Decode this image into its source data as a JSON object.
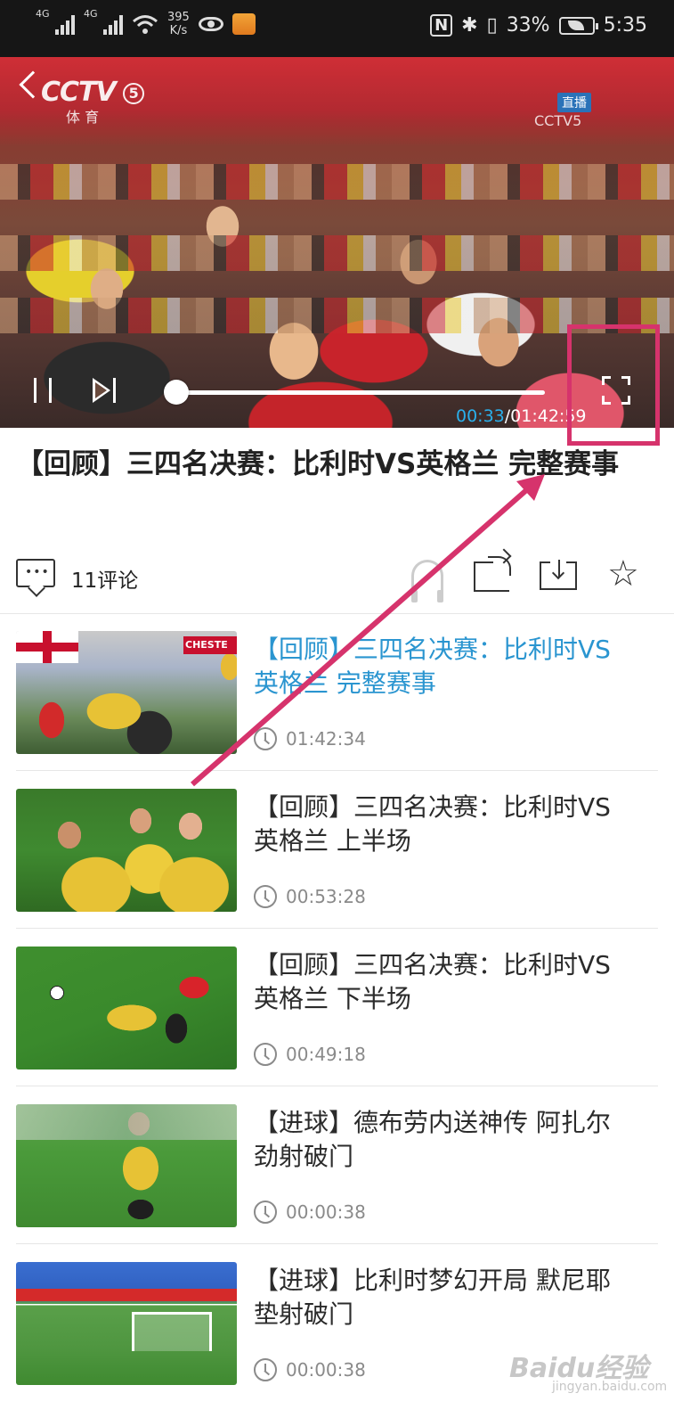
{
  "status_bar": {
    "signal_1_label": "4G",
    "signal_2_label": "4G",
    "net_speed_value": "395",
    "net_speed_unit": "K/s",
    "nfc_label": "N",
    "bluetooth_label": "✱",
    "vibrate_label": "▯",
    "battery_percent": "33%",
    "time": "5:35"
  },
  "player": {
    "channel_logo": "CCTV",
    "channel_number": "5",
    "channel_sub": "体 育",
    "live_tag": "直播",
    "corner_logo": "CCTV5",
    "current_time": "00:33",
    "time_separator": "/",
    "total_time": "01:42:59",
    "progress_fraction": 0.005,
    "accent_color": "#2aa6e0"
  },
  "video": {
    "title": "【回顾】三四名决赛：比利时VS英格兰 完整赛事"
  },
  "actions": {
    "comment_label": "11评论",
    "comment_icon_dots": "•••",
    "star_glyph": "☆"
  },
  "playlist": [
    {
      "title": "【回顾】三四名决赛：比利时VS英格兰 完整赛事",
      "duration": "01:42:34",
      "active": true,
      "thumb_board": "CHESTE"
    },
    {
      "title": "【回顾】三四名决赛：比利时VS英格兰 上半场",
      "duration": "00:53:28",
      "active": false
    },
    {
      "title": "【回顾】三四名决赛：比利时VS英格兰 下半场",
      "duration": "00:49:18",
      "active": false
    },
    {
      "title": "【进球】德布劳内送神传 阿扎尔劲射破门",
      "duration": "00:00:38",
      "active": false
    },
    {
      "title": "【进球】比利时梦幻开局 默尼耶垫射破门",
      "duration": "00:00:38",
      "active": false
    }
  ],
  "watermark": {
    "brand": "Baidu经验",
    "site": "jingyan.baidu.com"
  },
  "colors": {
    "highlight": "#d6336c",
    "active_title": "#2a95d0"
  }
}
